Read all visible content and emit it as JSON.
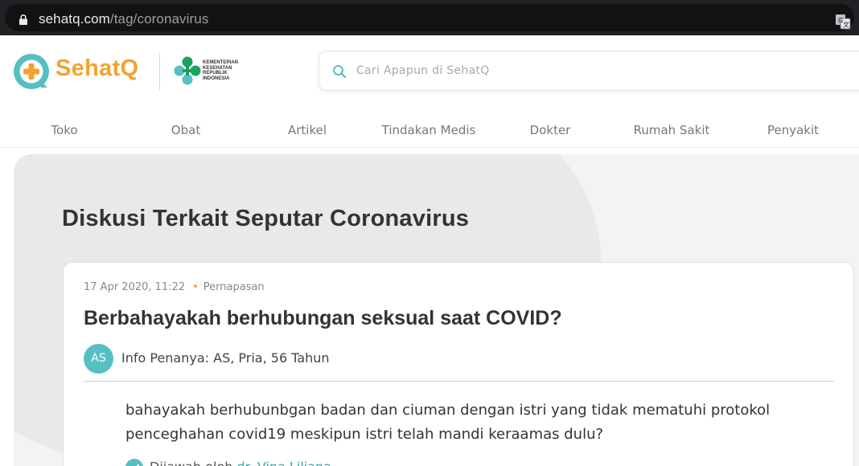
{
  "browser": {
    "url_host": "sehatq.com",
    "url_path": "/tag/coronavirus"
  },
  "brand": {
    "name": "SehatQ",
    "color": "#f4a22c",
    "teal": "#56bfc3",
    "partner_lines": [
      "KEMENTERIAN",
      "KESEHATAN",
      "REPUBLIK",
      "INDONESIA"
    ]
  },
  "search": {
    "placeholder": "Cari Apapun di SehatQ"
  },
  "nav": {
    "items": [
      {
        "label": "Toko"
      },
      {
        "label": "Obat"
      },
      {
        "label": "Artikel"
      },
      {
        "label": "Tindakan Medis"
      },
      {
        "label": "Dokter"
      },
      {
        "label": "Rumah Sakit"
      },
      {
        "label": "Penyakit"
      }
    ]
  },
  "main": {
    "section_title": "Diskusi Terkait Seputar Coronavirus",
    "question": {
      "date": "17 Apr 2020, 11:22",
      "category": "Pernapasan",
      "title": "Berbahayakah berhubungan seksual saat COVID?",
      "avatar_initials": "AS",
      "asker_info": "Info Penanya: AS, Pria, 56 Tahun",
      "body": "bahayakah berhubunbgan badan dan ciuman dengan istri yang tidak mematuhi protokol penceghahan covid19 meskipun istri telah mandi keraamas dulu?",
      "answered_prefix": "Dijawab oleh",
      "answered_by": "dr. Vina Liliana"
    }
  }
}
